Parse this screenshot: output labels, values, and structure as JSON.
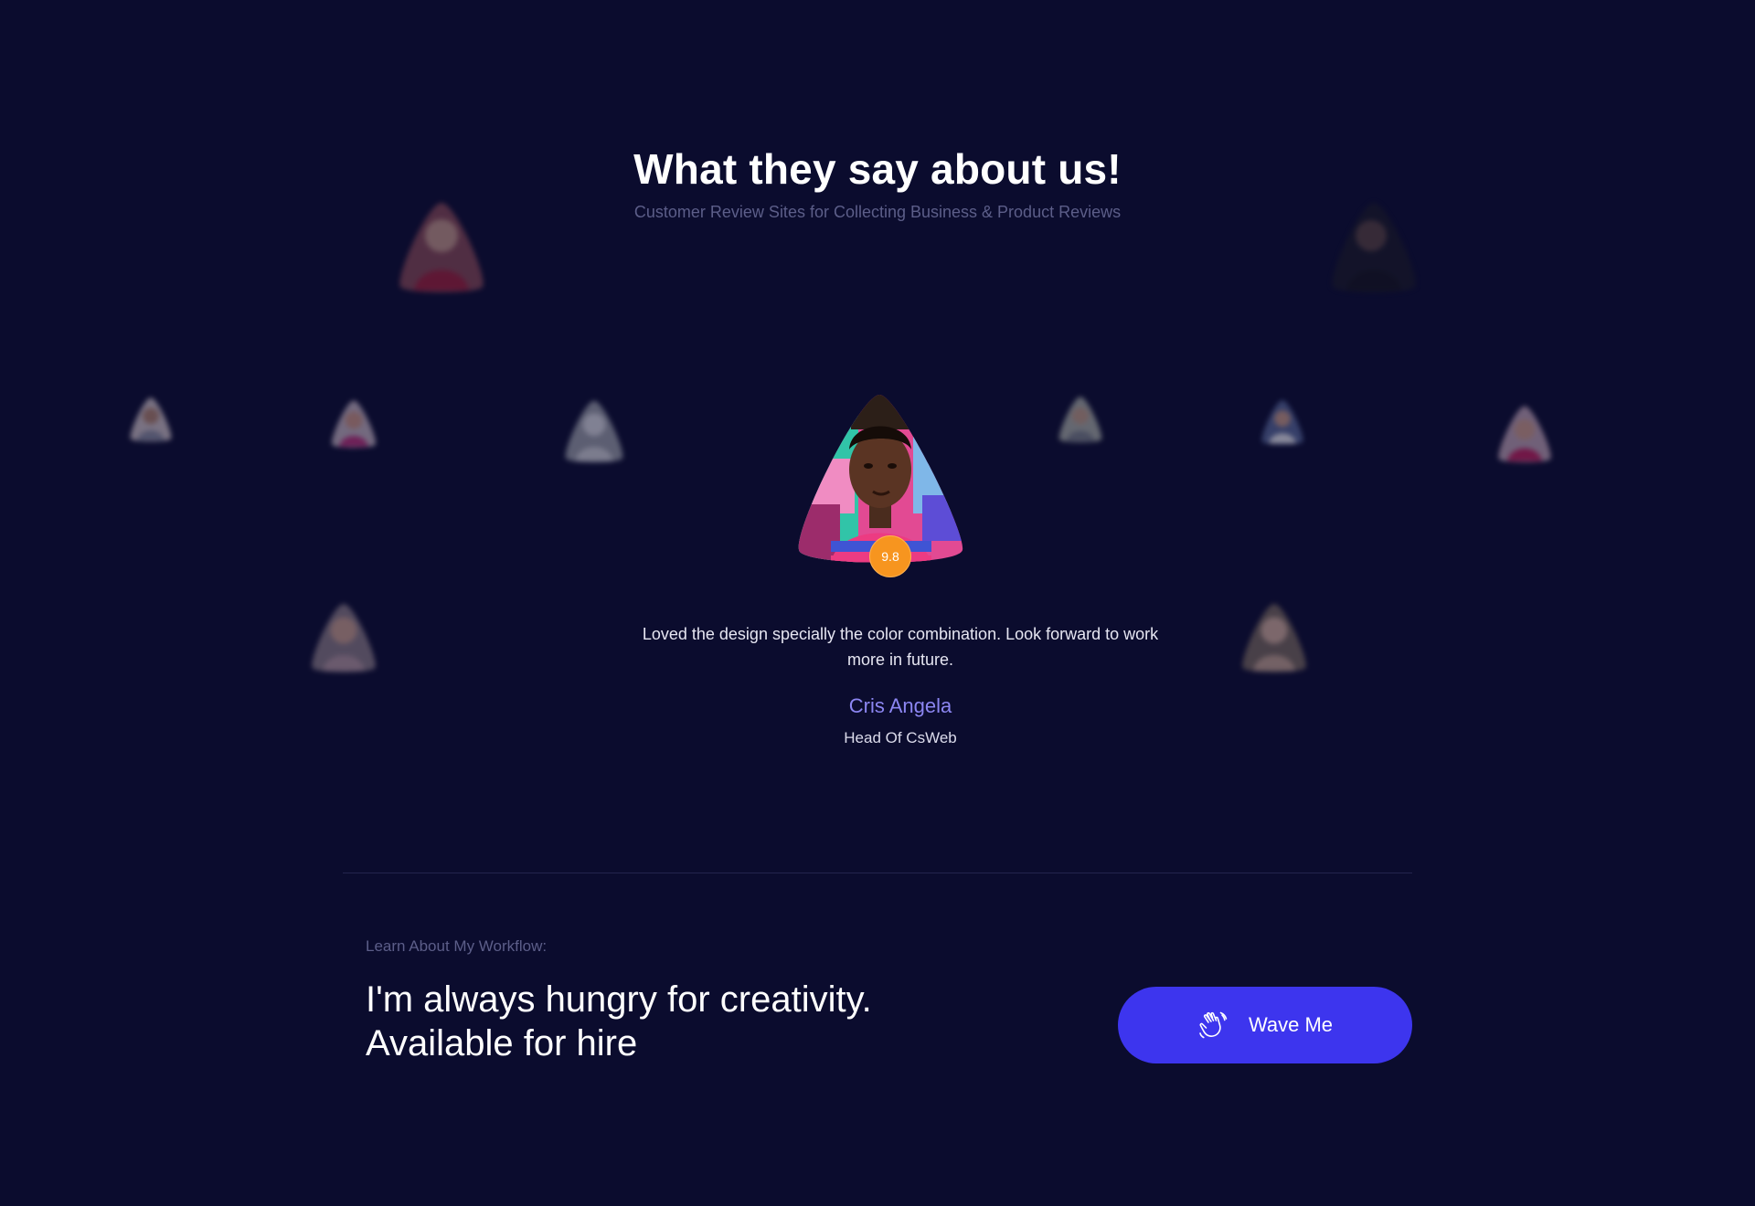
{
  "testimonials": {
    "title": "What they say about us!",
    "subtitle": "Customer Review Sites for Collecting Business & Product Reviews",
    "active": {
      "rating": "9.8",
      "quote": "Loved the design specially the color combination. Look forward to work more in future.",
      "name": "Cris Angela",
      "role": "Head Of CsWeb"
    },
    "rating_color": "#f7951f",
    "name_color": "#8c86f2"
  },
  "workflow": {
    "label": "Learn About My Workflow:",
    "headline_line1": "I'm always hungry for creativity.",
    "headline_line2": "Available for hire",
    "button_label": "Wave Me",
    "button_icon": "waving-hand-icon",
    "button_color": "#3d35ee"
  },
  "colors": {
    "background": "#0b0c2e",
    "muted_text": "#5c5e89"
  }
}
